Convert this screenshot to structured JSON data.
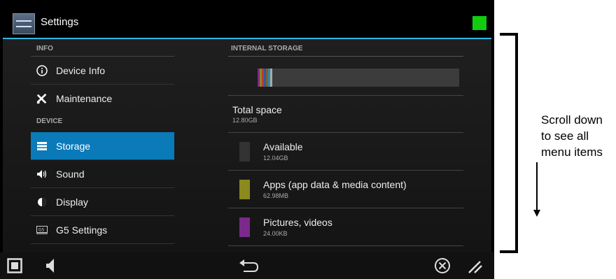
{
  "window": {
    "title": "Settings"
  },
  "left_menu": {
    "info_header": "INFO",
    "device_header": "DEVICE",
    "items": [
      {
        "label": "Device Info"
      },
      {
        "label": "Maintenance"
      },
      {
        "label": "Storage"
      },
      {
        "label": "Sound"
      },
      {
        "label": "Display"
      },
      {
        "label": "G5 Settings"
      }
    ]
  },
  "storage": {
    "header": "INTERNAL STORAGE",
    "total_label": "Total space",
    "total_value": "12.80GB",
    "categories": [
      {
        "label": "Available",
        "value": "12.04GB",
        "color": "#333333"
      },
      {
        "label": "Apps (app data & media content)",
        "value": "62.98MB",
        "color": "#8a8a1e"
      },
      {
        "label": "Pictures, videos",
        "value": "24.00KB",
        "color": "#7a2a8a"
      }
    ]
  },
  "annotation": {
    "line1": "Scroll down",
    "line2": "to see all",
    "line3": "menu items"
  },
  "colors": {
    "accent": "#33b5e5",
    "selected": "#0a7ab8",
    "status_indicator": "#11cc11"
  }
}
